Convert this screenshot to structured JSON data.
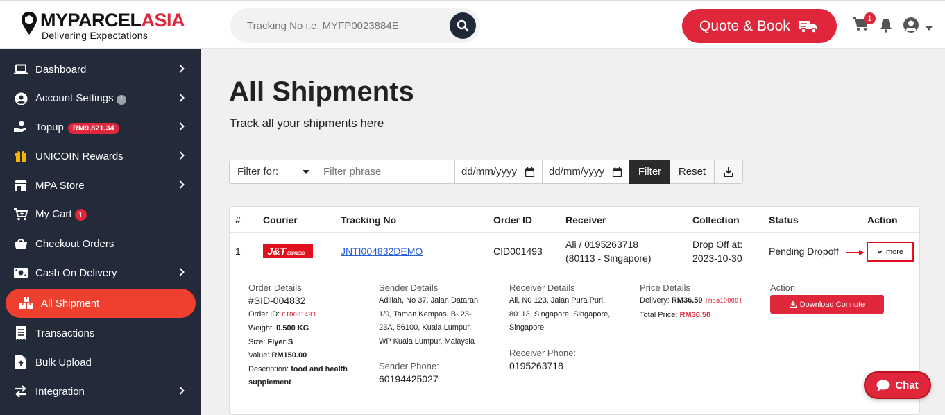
{
  "header": {
    "logo_main_a": "MYPARCEL",
    "logo_main_b": "ASIA",
    "logo_sub": "Delivering Expectations",
    "search_placeholder": "Tracking No i.e. MYFP0023884E",
    "quote_label": "Quote & Book",
    "cart_count": "1"
  },
  "sidebar": {
    "items": [
      {
        "label": "Dashboard",
        "icon": "laptop-icon"
      },
      {
        "label": "Account Settings",
        "icon": "user-circle-icon",
        "info": "!"
      },
      {
        "label": "Topup",
        "icon": "hand-coin-icon",
        "badge": "RM9,821.34"
      },
      {
        "label": "UNICOIN Rewards",
        "icon": "gift-icon"
      },
      {
        "label": "MPA Store",
        "icon": "store-icon"
      },
      {
        "label": "My Cart",
        "icon": "cart-icon",
        "badge": "1"
      },
      {
        "label": "Checkout Orders",
        "icon": "shopping-bag-icon"
      },
      {
        "label": "Cash On Delivery",
        "icon": "money-icon"
      },
      {
        "label": "All Shipment",
        "icon": "boxes-icon"
      },
      {
        "label": "Transactions",
        "icon": "receipt-icon"
      },
      {
        "label": "Bulk Upload",
        "icon": "file-upload-icon"
      },
      {
        "label": "Integration",
        "icon": "exchange-icon"
      }
    ]
  },
  "main": {
    "title": "All Shipments",
    "subtitle": "Track all your shipments here",
    "filter": {
      "select_value": "Filter for:",
      "phrase_placeholder": "Filter phrase",
      "date_from": "dd/mm/yyyy",
      "date_to": "dd/mm/yyyy",
      "filter_label": "Filter",
      "reset_label": "Reset"
    },
    "table": {
      "headers": [
        "#",
        "Courier",
        "Tracking No",
        "Order ID",
        "Receiver",
        "Collection",
        "Status",
        "Action"
      ],
      "row": {
        "index": "1",
        "courier": "J&T",
        "courier_sub": "EXPRESS",
        "tracking_no": "JNTI004832DEMO",
        "order_id": "CID001493",
        "receiver_line1": "Ali / 0195263718",
        "receiver_line2": "(80113 - Singapore)",
        "collection_line1": "Drop Off at:",
        "collection_line2": "2023-10-30",
        "status": "Pending Dropoff",
        "action_label": "more"
      },
      "details": {
        "order": {
          "heading": "Order Details",
          "sid": "#SID-004832",
          "order_id_label": "Order ID:",
          "order_id": "CID001493",
          "weight_label": "Weight:",
          "weight": "0.500 KG",
          "size_label": "Size:",
          "size": "Flyer S",
          "value_label": "Value:",
          "value": "RM150.00",
          "desc_label": "Description:",
          "desc_a": "food and health",
          "desc_b": "supplement"
        },
        "sender": {
          "heading": "Sender Details",
          "addr1": "Adillah, No 37, Jalan Dataran",
          "addr2": "1/9, Taman Kempas, B- 23-",
          "addr3": "23A, 56100, Kuala Lumpur,",
          "addr4": "WP Kuala Lumpur, Malaysia",
          "phone_heading": "Sender Phone:",
          "phone": "60194425027"
        },
        "receiver": {
          "heading": "Receiver Details",
          "addr1": "Ali, N0 123, Jalan Pura Puri,",
          "addr2": "80113, Singapore, Singapore,",
          "addr3": "Singapore",
          "phone_heading": "Receiver Phone:",
          "phone": "0195263718"
        },
        "price": {
          "heading": "Price Details",
          "delivery_label": "Delivery:",
          "delivery": "RM36.50",
          "promo": "[mpa10000]",
          "total_label": "Total Price:",
          "total": "RM36.50"
        },
        "action": {
          "heading": "Action",
          "download_label": "Download Connote"
        }
      }
    }
  },
  "chat_label": "Chat"
}
